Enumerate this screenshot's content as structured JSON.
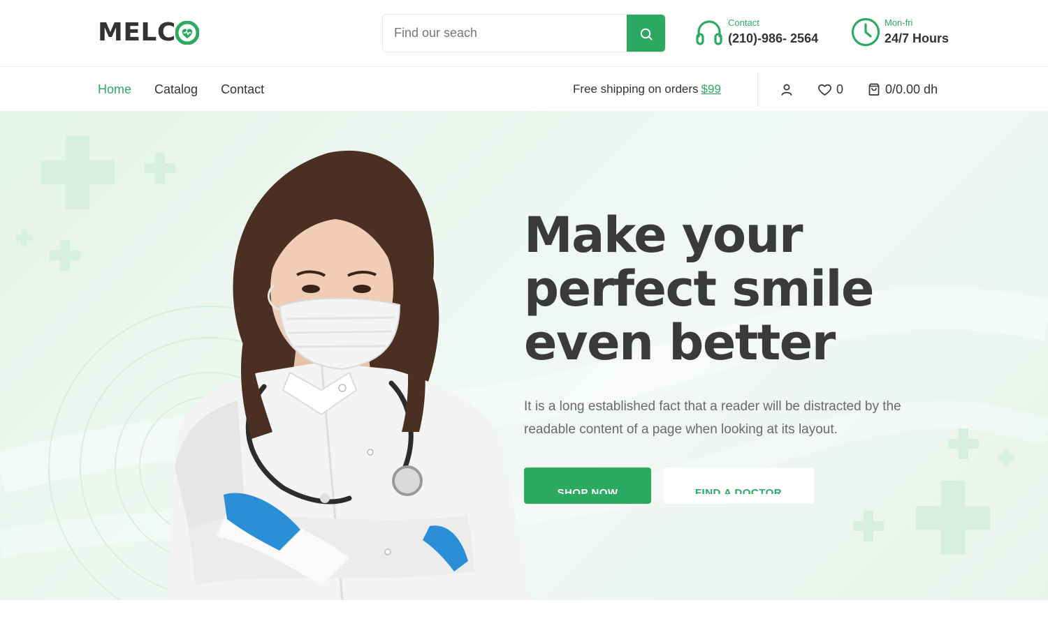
{
  "brand": {
    "name": "MELC",
    "logo_icon": "heart-circle-icon"
  },
  "search": {
    "placeholder": "Find our seach",
    "button_icon": "search-icon"
  },
  "contact": {
    "label": "Contact",
    "value": "(210)-986- 2564",
    "icon": "headset-icon"
  },
  "hours": {
    "label": "Mon-fri",
    "value": "24/7 Hours",
    "icon": "clock-icon"
  },
  "nav": {
    "links": [
      {
        "label": "Home",
        "active": true
      },
      {
        "label": "Catalog",
        "active": false
      },
      {
        "label": "Contact",
        "active": false
      }
    ],
    "shipping_text": "Free shipping on orders",
    "shipping_price": "$99",
    "account_icon": "user-icon",
    "wishlist_icon": "heart-icon",
    "wishlist_count": "0",
    "cart_icon": "shopping-bag-icon",
    "cart_summary": "0/0.00 dh"
  },
  "hero": {
    "title_lines": [
      "Make your",
      "perfect smile",
      "even better"
    ],
    "description": "It is a long established fact that a reader will be distracted by the readable content of a page when looking at its layout.",
    "primary_button": "SHOP NOW",
    "secondary_button": "FIND A DOCTOR",
    "image": "doctor-portrait"
  },
  "colors": {
    "accent": "#2daa62",
    "text": "#333333",
    "hero_bg": "#e9f6ef"
  }
}
